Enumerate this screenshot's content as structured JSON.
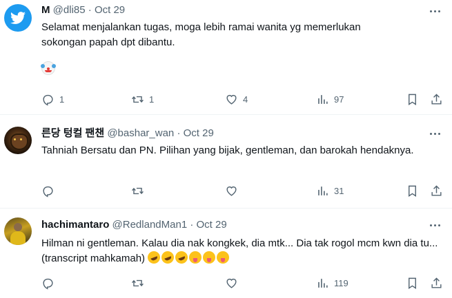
{
  "tweets": [
    {
      "name": "M",
      "handle": "@dli85",
      "sep": "·",
      "date": "Oct 29",
      "text": "Selamat menjalankan tugas, moga lebih ramai wanita yg memerlukan sokongan papah dpt dibantu.",
      "emoji": "clown-face-emoji",
      "replies": "1",
      "retweets": "1",
      "likes": "4",
      "views": "97"
    },
    {
      "name": "른당 텅컬 팬챈",
      "handle": "@bashar_wan",
      "sep": "·",
      "date": "Oct 29",
      "text": "Tahniah Bersatu dan PN. Pilihan yang bijak, gentleman, dan barokah hendaknya.",
      "replies": "",
      "retweets": "",
      "likes": "",
      "views": "31"
    },
    {
      "name": "hachimantaro",
      "handle": "@RedlandMan1",
      "sep": "·",
      "date": "Oct 29",
      "text": "Hilman ni gentleman. Kalau dia nak kongkek, dia mtk... Dia tak rogol mcm kwn dia tu... (transcript mahkamah)",
      "emojis": [
        "rofl-emoji",
        "rofl-emoji",
        "rofl-emoji",
        "squinting-tongue-emoji",
        "squinting-tongue-emoji",
        "squinting-tongue-emoji"
      ],
      "replies": "",
      "retweets": "",
      "likes": "",
      "views": "119"
    }
  ],
  "colors": {
    "text": "#0f1419",
    "muted": "#536471",
    "divider": "#eff3f4",
    "twitter_blue": "#1d9bf0"
  }
}
